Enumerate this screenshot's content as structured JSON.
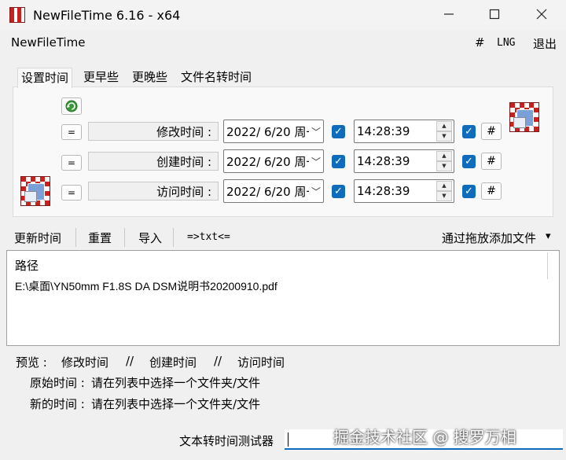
{
  "window": {
    "title": "NewFileTime 6.16 - x64",
    "minimize": "—",
    "maximize": "☐",
    "close": "✕"
  },
  "menu": {
    "app_name": "NewFileTime",
    "hash": "#",
    "lng": "LNG",
    "exit": "退出"
  },
  "tabs": [
    "设置时间",
    "更早些",
    "更晚些",
    "文件名转时间"
  ],
  "rows": [
    {
      "eq": "=",
      "label": "修改时间 :",
      "date": "2022/  6/20 周一",
      "time": "14:28:39",
      "hash": "#"
    },
    {
      "eq": "=",
      "label": "创建时间 :",
      "date": "2022/  6/20 周一",
      "time": "14:28:39",
      "hash": "#"
    },
    {
      "eq": "=",
      "label": "访问时间 :",
      "date": "2022/  6/20 周一",
      "time": "14:28:39",
      "hash": "#"
    }
  ],
  "toolbar": {
    "update": "更新时间",
    "reset": "重置",
    "import": "导入",
    "txt": "=>txt<=",
    "drag_add": "通过拖放添加文件",
    "drag_arrow": "▾"
  },
  "list": {
    "header": "路径",
    "items": [
      "E:\\桌面\\YN50mm F1.8S DA DSM说明书20200910.pdf"
    ]
  },
  "preview": {
    "label": "预览 :",
    "modified": "修改时间",
    "sep1": "//",
    "created": "创建时间",
    "sep2": "//",
    "accessed": "访问时间",
    "original_label": "原始时间 :",
    "original_value": "请在列表中选择一个文件夹/文件",
    "new_label": "新的时间 :",
    "new_value": "请在列表中选择一个文件夹/文件"
  },
  "tester": {
    "label": "文本转时间测试器",
    "value": ""
  },
  "watermark": "掘金技术社区 @ 搜罗万相"
}
